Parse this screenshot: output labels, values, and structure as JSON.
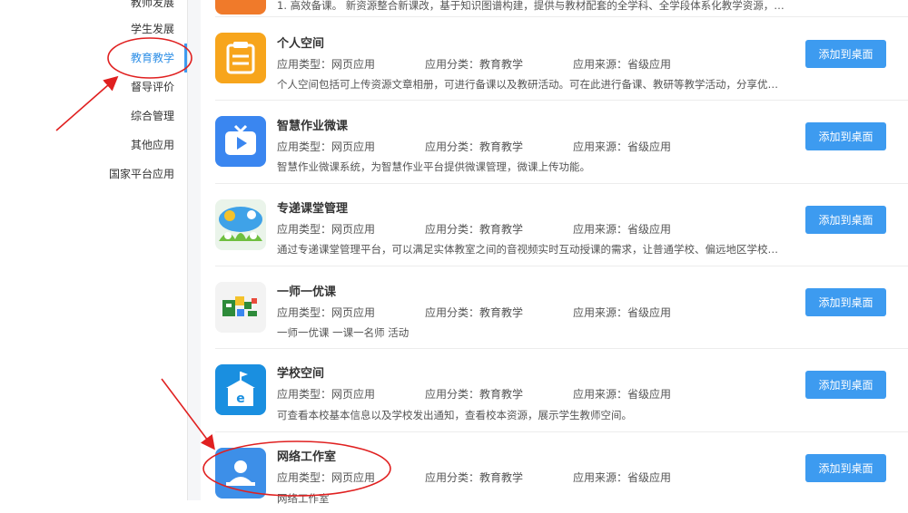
{
  "sidebar": {
    "items": [
      {
        "label": "教师发展"
      },
      {
        "label": "学生发展"
      },
      {
        "label": "教育教学",
        "active": true
      },
      {
        "label": "督导评价"
      },
      {
        "label": "综合管理"
      },
      {
        "label": "其他应用"
      },
      {
        "label": "国家平台应用"
      }
    ]
  },
  "meta_labels": {
    "type_label": "应用类型：",
    "category_label": "应用分类：",
    "source_label": "应用来源："
  },
  "top_partial_desc": "1. 高效备课。 新资源整合新课改，基于知识图谱构建，提供与教材配套的全学科、全学段体系化教学资源，通过...",
  "apps": [
    {
      "name": "个人空间",
      "type": "网页应用",
      "category": "教育教学",
      "source": "省级应用",
      "desc": "个人空间包括可上传资源文章相册，可进行备课以及教研活动。可在此进行备课、教研等教学活动，分享优秀资...",
      "button": "添加到桌面",
      "icon": "notepad-icon",
      "color": "#f5a623"
    },
    {
      "name": "智慧作业微课",
      "type": "网页应用",
      "category": "教育教学",
      "source": "省级应用",
      "desc": "智慧作业微课系统，为智慧作业平台提供微课管理，微课上传功能。",
      "button": "添加到桌面",
      "icon": "video-play-icon",
      "color": "#3a86f0"
    },
    {
      "name": "专递课堂管理",
      "type": "网页应用",
      "category": "教育教学",
      "source": "省级应用",
      "desc": "通过专递课堂管理平台，可以满足实体教室之间的音视频实时互动授课的需求，让普通学校、偏远地区学校的孩...",
      "button": "添加到桌面",
      "icon": "classroom-icon",
      "color": "#6fbf3f"
    },
    {
      "name": "一师一优课",
      "type": "网页应用",
      "category": "教育教学",
      "source": "省级应用",
      "desc": "一师一优课 一课一名师 活动",
      "button": "添加到桌面",
      "icon": "yishi-logo-icon",
      "color": "#2e8b3a"
    },
    {
      "name": "学校空间",
      "type": "网页应用",
      "category": "教育教学",
      "source": "省级应用",
      "desc": "可查看本校基本信息以及学校发出通知，查看校本资源，展示学生教师空间。",
      "button": "添加到桌面",
      "icon": "school-icon",
      "color": "#1a8fe0"
    },
    {
      "name": "网络工作室",
      "type": "网页应用",
      "category": "教育教学",
      "source": "省级应用",
      "desc": "网络工作室",
      "button": "添加到桌面",
      "icon": "studio-icon",
      "color": "#3d8fe8"
    }
  ],
  "colors": {
    "accent": "#3d9bf0",
    "annotation": "#e02020"
  }
}
